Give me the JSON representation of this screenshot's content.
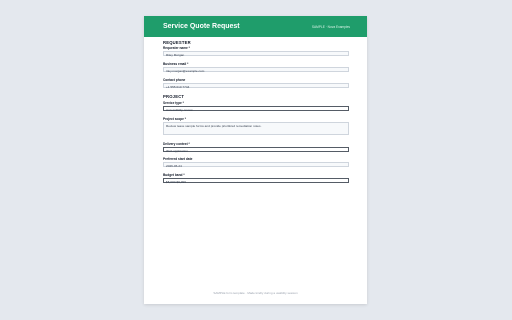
{
  "form": {
    "title": "Service Quote Request",
    "tag": "SAMPLE · Nova Examples"
  },
  "requester": {
    "heading": "REQUESTER",
    "name_label": "Requester name *",
    "name_value": "Riley Morgan",
    "email_label": "Business email *",
    "email_value": "riley.morgan@example.com",
    "phone_label": "Contact phone",
    "phone_value": "+1 555 010 7744"
  },
  "project": {
    "heading": "PROJECT",
    "service_label": "Service type *",
    "service_value": "Accessibility review",
    "scope_label": "Project scope *",
    "scope_value": "Review leave sample forms and provide prioritized remediation notes.",
    "delivery_label": "Delivery context *",
    "delivery_value": "Web application",
    "start_label": "Preferred start date",
    "start_value": "2026-06-24",
    "budget_label": "Budget band *",
    "budget_value": "$5,000-$9,999"
  },
  "footer": {
    "note": "SAMPLE form template · Made kindly during a usability session"
  }
}
